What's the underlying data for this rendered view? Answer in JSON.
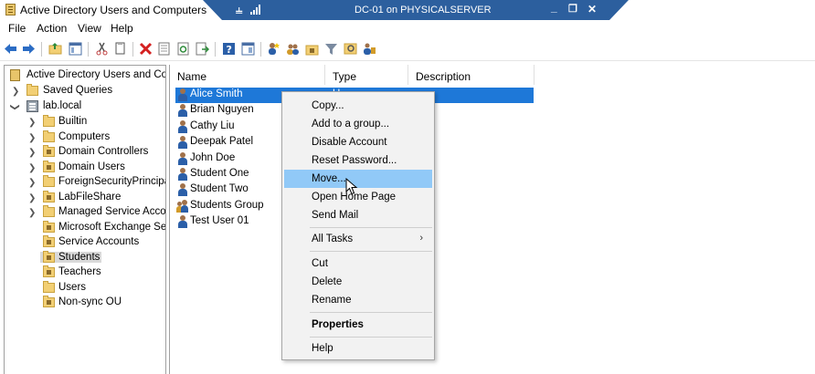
{
  "window": {
    "title": "Active Directory Users and Computers"
  },
  "rdp": {
    "title": "DC-01 on PHYSICALSERVER",
    "pin_glyph": "⫨",
    "minimize_glyph": "_",
    "restore_glyph": "❐",
    "close_glyph": "✕"
  },
  "menu": {
    "items": [
      "File",
      "Action",
      "View",
      "Help"
    ]
  },
  "toolbar": {
    "buttons": [
      "back-icon",
      "forward-icon",
      "up-folder-icon",
      "show-hide-tree-icon",
      "cut-icon",
      "copy-icon",
      "delete-icon",
      "properties-icon",
      "refresh-icon",
      "export-list-icon",
      "help-icon",
      "show-pane-icon",
      "new-user-icon",
      "new-group-icon",
      "new-ou-icon",
      "filter-icon",
      "find-icon",
      "add-to-group-icon"
    ]
  },
  "tree": {
    "root": "Active Directory Users and Com",
    "saved_queries": "Saved Queries",
    "domain": "lab.local",
    "containers": [
      {
        "label": "Builtin",
        "type": "folder",
        "expandable": true
      },
      {
        "label": "Computers",
        "type": "folder",
        "expandable": true
      },
      {
        "label": "Domain Controllers",
        "type": "ou",
        "expandable": true
      },
      {
        "label": "Domain Users",
        "type": "ou",
        "expandable": true
      },
      {
        "label": "ForeignSecurityPrincipals",
        "type": "folder",
        "expandable": true
      },
      {
        "label": "LabFileShare",
        "type": "ou",
        "expandable": true
      },
      {
        "label": "Managed Service Accoun",
        "type": "folder",
        "expandable": true
      },
      {
        "label": "Microsoft Exchange Secu",
        "type": "ou",
        "expandable": false
      },
      {
        "label": "Service Accounts",
        "type": "ou",
        "expandable": false
      },
      {
        "label": "Students",
        "type": "ou",
        "expandable": false,
        "selected": true
      },
      {
        "label": "Teachers",
        "type": "ou",
        "expandable": false
      },
      {
        "label": "Users",
        "type": "folder",
        "expandable": false
      },
      {
        "label": "Non-sync OU",
        "type": "ou",
        "expandable": false
      }
    ]
  },
  "list": {
    "columns": [
      "Name",
      "Type",
      "Description"
    ],
    "rows": [
      {
        "name": "Alice Smith",
        "type": "U",
        "kind": "user",
        "selected": true
      },
      {
        "name": "Brian Nguyen",
        "type": "",
        "kind": "user"
      },
      {
        "name": "Cathy Liu",
        "type": "",
        "kind": "user"
      },
      {
        "name": "Deepak Patel",
        "type": "",
        "kind": "user"
      },
      {
        "name": "John Doe",
        "type": "",
        "kind": "user"
      },
      {
        "name": "Student One",
        "type": "",
        "kind": "user"
      },
      {
        "name": "Student Two",
        "type": "",
        "kind": "user"
      },
      {
        "name": "Students Group",
        "type": "",
        "kind": "group"
      },
      {
        "name": "Test User 01",
        "type": "",
        "kind": "user"
      }
    ]
  },
  "context_menu": {
    "items": [
      "Copy...",
      "Add to a group...",
      "Disable Account",
      "Reset Password...",
      "Move...",
      "Open Home Page",
      "Send Mail",
      "All Tasks",
      "Cut",
      "Delete",
      "Rename",
      "Properties",
      "Help"
    ],
    "highlighted": "Move...",
    "submenu_arrow": "›"
  },
  "colors": {
    "selection": "#1e78d8",
    "menu_highlight": "#91c9f7",
    "rdp_bar": "#2c5f9e"
  }
}
